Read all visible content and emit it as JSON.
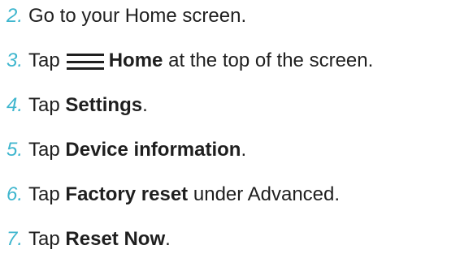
{
  "accent_color": "#3fb6ce",
  "text_color": "#1f1f1f",
  "steps": [
    {
      "number": "2.",
      "text": "Go to your Home screen."
    },
    {
      "number": "3.",
      "before": "Tap",
      "icon": "hamburger-menu-icon",
      "bold": "Home",
      "after": "at the top of the screen."
    },
    {
      "number": "4.",
      "before": "Tap",
      "bold": "Settings",
      "after": "."
    },
    {
      "number": "5.",
      "before": "Tap",
      "bold": "Device information",
      "after": "."
    },
    {
      "number": "6.",
      "before": "Tap",
      "bold": "Factory reset",
      "after": "under Advanced."
    },
    {
      "number": "7.",
      "before": "Tap",
      "bold": "Reset Now",
      "after": "."
    }
  ]
}
